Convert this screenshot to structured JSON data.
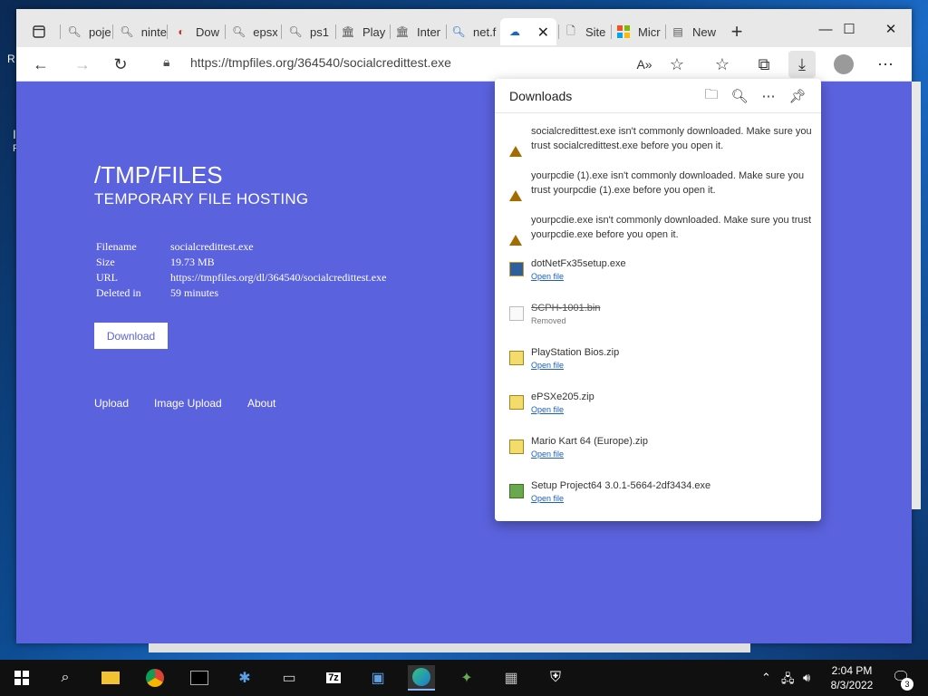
{
  "desktop": {
    "edge_text_1": "R",
    "edge_text_2": "I",
    "edge_text_3": "F"
  },
  "tabs": [
    {
      "label": "poje",
      "icon": "search-icon"
    },
    {
      "label": "ninte",
      "icon": "search-icon"
    },
    {
      "label": "Dow",
      "icon": "site-icon"
    },
    {
      "label": "epsx",
      "icon": "search-icon"
    },
    {
      "label": "ps1",
      "icon": "search-icon"
    },
    {
      "label": "Play",
      "icon": "archive-icon"
    },
    {
      "label": "Inter",
      "icon": "archive-icon"
    },
    {
      "label": "net.f",
      "icon": "search-icon"
    },
    {
      "label": "",
      "icon": "cloud-icon"
    },
    {
      "label": "Site",
      "icon": "document-icon"
    },
    {
      "label": "Micr",
      "icon": "microsoft-icon"
    },
    {
      "label": "New",
      "icon": "newtab-icon"
    }
  ],
  "toolbar": {
    "url": "https://tmpfiles.org/364540/socialcredittest.exe"
  },
  "site": {
    "title": "/TMP/FILES",
    "subtitle": "TEMPORARY FILE HOSTING",
    "info": [
      {
        "key": "Filename",
        "value": "socialcredittest.exe"
      },
      {
        "key": "Size",
        "value": "19.73 MB"
      },
      {
        "key": "URL",
        "value": "https://tmpfiles.org/dl/364540/socialcredittest.exe"
      },
      {
        "key": "Deleted in",
        "value": "59 minutes"
      }
    ],
    "download_label": "Download",
    "links": [
      "Upload",
      "Image Upload",
      "About"
    ]
  },
  "downloads": {
    "title": "Downloads",
    "items": [
      {
        "type": "warning",
        "text": "socialcredittest.exe isn't commonly downloaded. Make sure you trust socialcredittest.exe before you open it."
      },
      {
        "type": "warning",
        "text": "yourpcdie (1).exe isn't commonly downloaded. Make sure you trust yourpcdie (1).exe before you open it."
      },
      {
        "type": "warning",
        "text": "yourpcdie.exe isn't commonly downloaded. Make sure you trust yourpcdie.exe before you open it."
      },
      {
        "type": "file",
        "name": "dotNetFx35setup.exe",
        "action": "Open file",
        "icon": "installer-icon"
      },
      {
        "type": "removed",
        "name": "SCPH-1001.bin",
        "action": "Removed",
        "icon": "blank-file-icon"
      },
      {
        "type": "file",
        "name": "PlayStation Bios.zip",
        "action": "Open file",
        "icon": "zip-icon"
      },
      {
        "type": "file",
        "name": "ePSXe205.zip",
        "action": "Open file",
        "icon": "zip-icon"
      },
      {
        "type": "file",
        "name": "Mario Kart 64 (Europe).zip",
        "action": "Open file",
        "icon": "zip-icon"
      },
      {
        "type": "file",
        "name": "Setup Project64 3.0.1-5664-2df3434.exe",
        "action": "Open file",
        "icon": "setup-icon"
      }
    ]
  },
  "taskbar": {
    "time": "2:04 PM",
    "date": "8/3/2022",
    "notifications": "3"
  }
}
